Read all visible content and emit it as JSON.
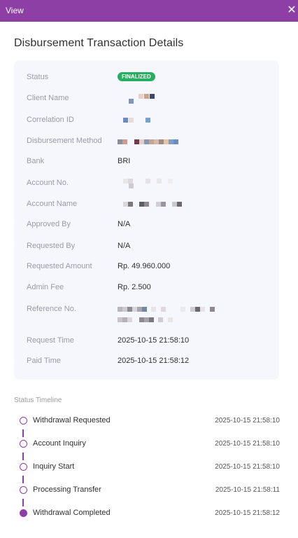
{
  "window": {
    "title": "View",
    "close_glyph": "✕",
    "close_icon": "close-icon"
  },
  "page": {
    "heading": "Disbursement Transaction Details"
  },
  "details": {
    "status": {
      "label": "Status",
      "value": "FINALIZED",
      "badge_color": "#27ae60"
    },
    "client_name": {
      "label": "Client Name"
    },
    "correlation_id": {
      "label": "Correlation ID"
    },
    "disbursement_method": {
      "label": "Disbursement Method"
    },
    "bank": {
      "label": "Bank",
      "value": "BRI"
    },
    "account_no": {
      "label": "Account No."
    },
    "account_name": {
      "label": "Account Name"
    },
    "approved_by": {
      "label": "Approved By",
      "value": "N/A"
    },
    "requested_by": {
      "label": "Requested By",
      "value": "N/A"
    },
    "requested_amount": {
      "label": "Requested Amount",
      "value": "Rp. 49.960.000"
    },
    "admin_fee": {
      "label": "Admin Fee",
      "value": "Rp. 2.500"
    },
    "reference_no": {
      "label": "Reference No."
    },
    "request_time": {
      "label": "Request Time",
      "value": "2025-10-15 21:58:10"
    },
    "paid_time": {
      "label": "Paid Time",
      "value": "2025-10-15 21:58:12"
    }
  },
  "timeline": {
    "label": "Status Timeline",
    "accent_color": "#8e3fa5",
    "items": [
      {
        "label": "Withdrawal Requested",
        "time": "2025-10-15 21:58:10"
      },
      {
        "label": "Account Inquiry",
        "time": "2025-10-15 21:58:10"
      },
      {
        "label": "Inquiry Start",
        "time": "2025-10-15 21:58:10"
      },
      {
        "label": "Processing Transfer",
        "time": "2025-10-15 21:58:11"
      },
      {
        "label": "Withdrawal Completed",
        "time": "2025-10-15 21:58:12"
      }
    ]
  }
}
